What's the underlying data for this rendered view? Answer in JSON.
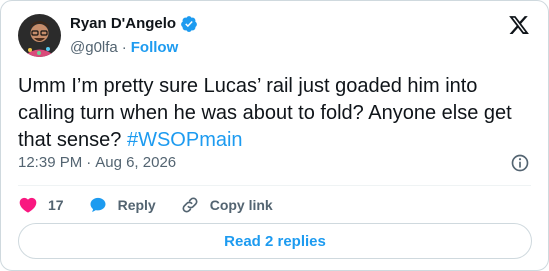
{
  "author": {
    "name": "Ryan D'Angelo",
    "handle": "@g0lfa",
    "separator": "·",
    "follow_label": "Follow"
  },
  "tweet": {
    "text": "Umm I’m pretty sure Lucas’ rail just goaded him into calling turn when he was about to fold? Anyone else get that sense? ",
    "hashtag": "#WSOPmain",
    "time": "12:39 PM",
    "date_separator": "·",
    "date": "Aug 6, 2026"
  },
  "actions": {
    "like_count": "17",
    "reply_label": "Reply",
    "copy_link_label": "Copy link"
  },
  "read_replies_label": "Read 2 replies",
  "colors": {
    "accent": "#1d9bf0",
    "like": "#f91880",
    "muted": "#536471",
    "text": "#0f1419"
  },
  "icons": [
    "verified-badge-icon",
    "x-logo-icon",
    "info-icon",
    "heart-icon",
    "reply-icon",
    "link-icon"
  ]
}
